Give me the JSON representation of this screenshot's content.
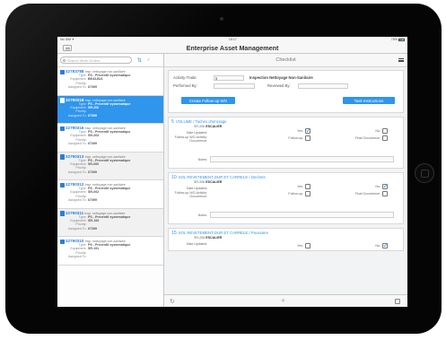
{
  "status_bar": {
    "left": "No SIM ✈",
    "time": "10:17",
    "battery": "75%"
  },
  "app": {
    "title": "Enterprise Asset Management"
  },
  "left_panel": {
    "search_placeholder": "Search Work Orders",
    "work_orders": [
      {
        "number": "22783788",
        "desc": "Insp. nettoyage non-sanitaire",
        "type": "PS - Preventif systematique",
        "equipment": "BE43-B21",
        "priority": "",
        "assigned": "67399"
      },
      {
        "number": "22790318",
        "desc": "Insp. nettoyage non-sanitaire",
        "type": "PS - Preventif systematique",
        "equipment": "SR-206",
        "priority": "",
        "assigned": "67399"
      },
      {
        "number": "22790316",
        "desc": "Insp. nettoyage non-sanitaire",
        "type": "PS - Preventif systematique",
        "equipment": "SR-203",
        "priority": "",
        "assigned": "67399"
      },
      {
        "number": "22790313",
        "desc": "Insp. nettoyage non-sanitaire",
        "type": "PS - Preventif systematique",
        "equipment": "SR-000",
        "priority": "",
        "assigned": "67399"
      },
      {
        "number": "22790312",
        "desc": "Insp. nettoyage non-sanitaire",
        "type": "PS - Preventif systematique",
        "equipment": "SR-002",
        "priority": "",
        "assigned": "67399"
      },
      {
        "number": "22790311",
        "desc": "Insp. nettoyage non-sanitaire",
        "type": "PS - Preventif systematique",
        "equipment": "SR-193",
        "priority": "",
        "assigned": "67399"
      },
      {
        "number": "22790310",
        "desc": "Insp. nettoyage non-sanitaire",
        "type": "PS - Preventif systematique",
        "equipment": "SR-191",
        "priority": "",
        "assigned": ""
      }
    ],
    "labels": {
      "type": "Type:",
      "equipment": "Equipment:",
      "priority": "Priority:",
      "assigned": "Assigned To:"
    }
  },
  "checklist": {
    "header": "Checklist",
    "activity_label": "Activity-Trade:",
    "activity_value": "5",
    "activity_desc": "Inspection Nettoyage Non-Sanitaire",
    "performed_by": "Performed By:",
    "reviewed_by": "Reviewed By:",
    "create_followup_btn": "Create Follow-up WO",
    "task_instructions_btn": "Task Instructions",
    "sections": [
      {
        "num": "5",
        "title": "VOLUME / Taches d'arrosage",
        "equip_code": "SR-206",
        "equip_name": "ESCALIER",
        "yes_checked": true,
        "no_checked": false
      },
      {
        "num": "10",
        "title": "SOL REVETEMENT DUR ET CARRELE / Dechets",
        "equip_code": "SR-206",
        "equip_name": "ESCALIER",
        "yes_checked": false,
        "no_checked": true
      },
      {
        "num": "15",
        "title": "SOL REVETEMENT DUR ET CARRELE / Poussiere",
        "equip_code": "SR-206",
        "equip_name": "ESCALIER",
        "yes_checked": false,
        "no_checked": true
      }
    ],
    "field_labels": {
      "date_updated": "Date Updated:",
      "followup_activity": "Follow-up WO-Activity:",
      "occurrence": "Occurrence:",
      "yes": "Yes:",
      "no": "No:",
      "followup": "Follow-up:",
      "final_occurrence": "Final Occurrence:",
      "notes": "Notes:"
    }
  },
  "colors": {
    "accent": "#2f95ed",
    "selected_row": "#2f95ed"
  }
}
